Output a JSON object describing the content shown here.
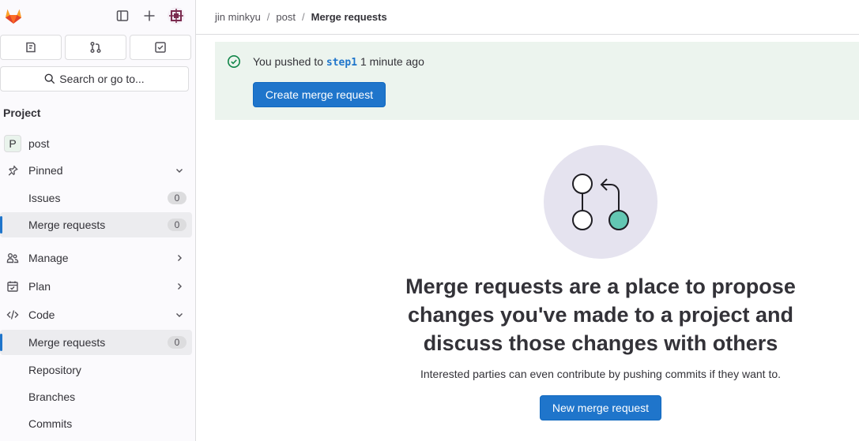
{
  "sidebar": {
    "search_label": "Search or go to...",
    "section_title": "Project",
    "project": {
      "avatar_letter": "P",
      "name": "post"
    },
    "pinned": {
      "label": "Pinned",
      "items": [
        {
          "label": "Issues",
          "count": "0"
        },
        {
          "label": "Merge requests",
          "count": "0"
        }
      ]
    },
    "manage_label": "Manage",
    "plan_label": "Plan",
    "code": {
      "label": "Code",
      "items": [
        {
          "label": "Merge requests",
          "count": "0"
        },
        {
          "label": "Repository"
        },
        {
          "label": "Branches"
        },
        {
          "label": "Commits"
        }
      ]
    }
  },
  "breadcrumb": {
    "user": "jin minkyu",
    "project": "post",
    "current": "Merge requests"
  },
  "alert": {
    "prefix": "You pushed to",
    "branch": "step1",
    "suffix": "1 minute ago",
    "button": "Create merge request"
  },
  "empty_state": {
    "title": "Merge requests are a place to propose changes you've made to a project and discuss those changes with others",
    "description": "Interested parties can even contribute by pushing commits if they want to.",
    "button": "New merge request"
  },
  "colors": {
    "accent": "#1f75cb",
    "alert_bg": "#ecf4ee",
    "success": "#108548",
    "illustration_bg": "#e5e3ef",
    "illustration_node": "#63c7b3"
  }
}
